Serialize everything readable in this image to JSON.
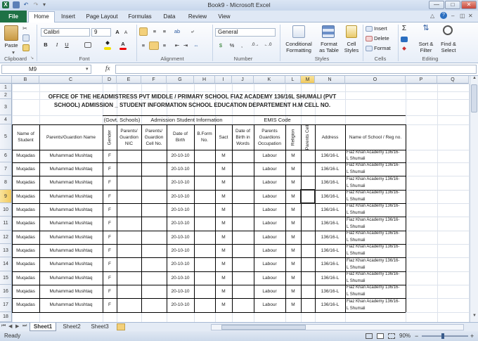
{
  "window": {
    "title": "Book9 - Microsoft Excel",
    "minimize": "—",
    "maximize": "□",
    "close": "✕"
  },
  "ribbon_tabs": [
    "File",
    "Home",
    "Insert",
    "Page Layout",
    "Formulas",
    "Data",
    "Review",
    "View"
  ],
  "clipboard": {
    "paste": "Paste",
    "group": "Clipboard"
  },
  "font": {
    "name": "Calibri",
    "size": "9",
    "group": "Font",
    "bold": "B",
    "italic": "I",
    "underline": "U"
  },
  "alignment": {
    "group": "Alignment"
  },
  "number": {
    "format": "General",
    "group": "Number",
    "currency": "$",
    "percent": "%",
    "comma": ","
  },
  "styles": {
    "conditional": [
      "Conditional",
      "Formatting"
    ],
    "table": [
      "Format",
      "as Table"
    ],
    "cell": [
      "Cell",
      "Styles"
    ],
    "group": "Styles"
  },
  "cells": {
    "insert": "Insert",
    "delete": "Delete",
    "format": "Format",
    "group": "Cells"
  },
  "editing": {
    "sort": [
      "Sort &",
      "Filter"
    ],
    "find": [
      "Find &",
      "Select"
    ],
    "group": "Editing"
  },
  "formula_bar": {
    "name_box": "M9",
    "fx": "fx",
    "content": ""
  },
  "columns": [
    "A",
    "B",
    "C",
    "D",
    "E",
    "F",
    "G",
    "H",
    "I",
    "J",
    "K",
    "L",
    "M",
    "N",
    "O",
    "P",
    "Q"
  ],
  "rows": [
    "1",
    "2",
    "3",
    "4",
    "5",
    "6",
    "7",
    "8",
    "9",
    "10",
    "11",
    "12",
    "13",
    "14",
    "15",
    "16",
    "17",
    "18"
  ],
  "sheet": {
    "title1": "OFFICE OF THE HEADMISTRESS PVT MIDDLE / PRIMARY SCHOOL FIAZ ACADEMY 136/16L SHUMALI (PVT",
    "title2": "SCHOOL) ADMISSION _ STUDENT INFORMATION SCHOOL EDUCATION DEPARTEMENT H.M CELL NO.",
    "sec1": "(Govt. Schools)",
    "sec2": "Admission Student Information",
    "sec3": "EMIS Code",
    "headers": {
      "b": [
        "Name of",
        "Student"
      ],
      "c": "Parents/Guardion Name",
      "d": "Gender",
      "e": [
        "Parents/",
        "Guardion",
        "NIC"
      ],
      "f": [
        "Parents/",
        "Guardion",
        "Cell No."
      ],
      "g": [
        "Date of",
        "Birth"
      ],
      "h": [
        "B.Form",
        "No."
      ],
      "i": "Sact",
      "j": [
        "Date of",
        "Birth in",
        "Words"
      ],
      "k": [
        "Parents",
        "Guardions",
        "Occupation"
      ],
      "l": "Religion",
      "m": "Parents Cell",
      "n": "Address",
      "o": "Name of School / Reg no."
    },
    "record": {
      "name": "Muqadas",
      "parent": "Muhammad Mushtaq",
      "gender": "F",
      "dob": "20-10-10",
      "sact": "M",
      "occupation": "Labour",
      "religion": "M",
      "address": "136/16-L",
      "school1": "Fiaz Khan Academy 136/16-",
      "school2": "L Shumali"
    }
  },
  "sheet_tabs": [
    "Sheet1",
    "Sheet2",
    "Sheet3"
  ],
  "status": {
    "left": "Ready",
    "zoom": "90%",
    "minus": "−",
    "plus": "+"
  }
}
